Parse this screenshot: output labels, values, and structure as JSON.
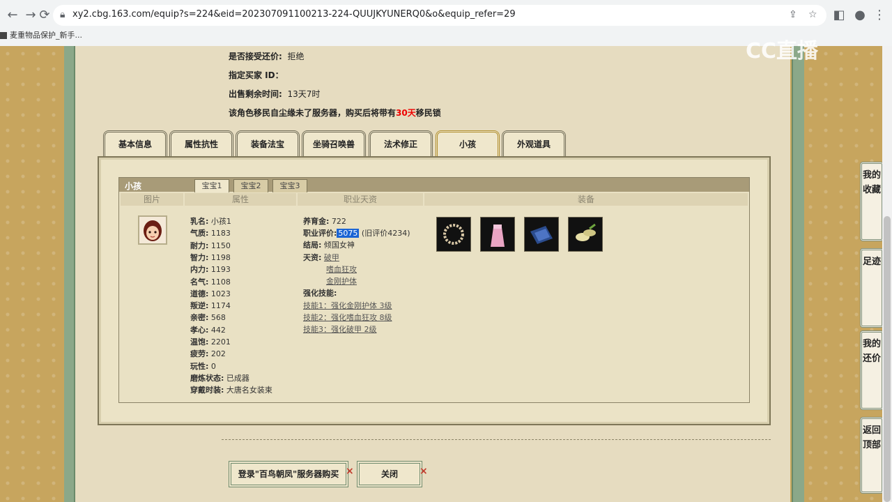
{
  "browser": {
    "url": "xy2.cbg.163.com/equip?s=224&eid=202307091100213-224-QUUJKYUNERQ0&o&equip_refer=29",
    "bookmark": "麦重物品保护_新手..."
  },
  "watermark": "CC直播",
  "info": {
    "bargain_label": "是否接受还价:",
    "bargain_value": "拒绝",
    "buyer_label": "指定买家 ID：",
    "remaining_label": "出售剩余时间:",
    "remaining_value": "13天7时",
    "migrate_pre": "该角色移民自尘缘未了服务器，购买后将带有",
    "migrate_days": "30天",
    "migrate_post": "移民锁"
  },
  "tabs": [
    "基本信息",
    "属性抗性",
    "装备法宝",
    "坐骑召唤兽",
    "法术修正",
    "小孩",
    "外观道具"
  ],
  "active_tab": "小孩",
  "kid_panel": {
    "title": "小孩",
    "subtabs": [
      "宝宝1",
      "宝宝2",
      "宝宝3"
    ],
    "columns": [
      "图片",
      "属性",
      "职业天资",
      "装备"
    ],
    "attributes": [
      {
        "k": "乳名:",
        "v": "小孩1"
      },
      {
        "k": "气质:",
        "v": "1183"
      },
      {
        "k": "耐力:",
        "v": "1150"
      },
      {
        "k": "智力:",
        "v": "1198"
      },
      {
        "k": "内力:",
        "v": "1193"
      },
      {
        "k": "名气:",
        "v": "1108"
      },
      {
        "k": "道德:",
        "v": "1023"
      },
      {
        "k": "叛逆:",
        "v": "1174"
      },
      {
        "k": "亲密:",
        "v": "568"
      },
      {
        "k": "孝心:",
        "v": "442"
      },
      {
        "k": "温饱:",
        "v": "2201"
      },
      {
        "k": "疲劳:",
        "v": "202"
      },
      {
        "k": "玩性:",
        "v": "0"
      },
      {
        "k": "磨炼状态:",
        "v": "已成器"
      },
      {
        "k": "穿戴时装:",
        "v": "大唐名女装束"
      }
    ],
    "job": {
      "money_label": "养育金:",
      "money_value": "722",
      "eval_label": "职业评价:",
      "eval_value": "5075",
      "eval_old": "(旧评价4234)",
      "ending_label": "结局:",
      "ending_value": "倾国女神",
      "talent_label": "天资:",
      "talents": [
        "破甲",
        "嗜血狂攻",
        "金刚护体"
      ],
      "enhance_label": "强化技能:",
      "skills": [
        "技能1：强化金刚护体 3级",
        "技能2：强化嗜血狂攻 8级",
        "技能3：强化破甲 2级"
      ]
    }
  },
  "buttons": {
    "login_buy": "登录\"百鸟朝凤\"服务器购买",
    "close": "关闭"
  },
  "side_nav": [
    "我的收藏",
    "足迹",
    "我的还价",
    "返回顶部"
  ]
}
